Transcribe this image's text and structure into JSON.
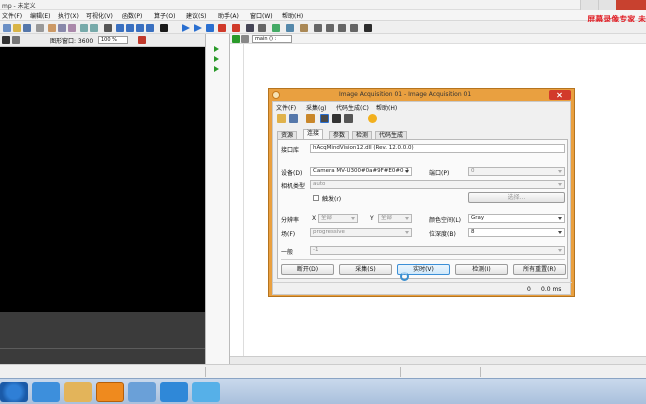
{
  "window": {
    "title": "mp - 未定义"
  },
  "menu": [
    "文件(F)",
    "编辑(E)",
    "执行(X)",
    "可视化(V)",
    "函数(P)",
    "算子(O)",
    "建议(S)",
    "助手(A)",
    "窗口(W)",
    "帮助(H)"
  ],
  "brand": "屏幕录像专家 未",
  "graphics_window": {
    "label": "图形窗口: 3600",
    "zoom": "100 %"
  },
  "editor": {
    "location": "main () :"
  },
  "dialog": {
    "title": "Image Acquisition 01 - Image Acquisition 01",
    "menu": [
      "文件(F)",
      "采集(g)",
      "代码生成(C)",
      "帮助(H)"
    ],
    "tabs": [
      "资源",
      "连接",
      "参数",
      "检测",
      "代码生成"
    ],
    "active_tab": 1,
    "fields": {
      "interface_label": "接口库",
      "interface_value": "hAcqMindVision12.dll (Rev. 12.0.0.0)",
      "device_label": "设备(D)",
      "device_value": "Camera MV-U300#0a#9F#E0#0 2",
      "port_label": "端口(P)",
      "port_value": "0",
      "camtype_label": "相机类型",
      "camtype_value": "auto",
      "trigger_label": "触发(r)",
      "select_button": "选择...",
      "res_label": "分辨率",
      "res_x_label": "X",
      "res_x_value": "全部",
      "res_y_label": "Y",
      "res_y_value": "全部",
      "colorspace_label": "颜色空间(L)",
      "colorspace_value": "Gray",
      "field_label": "场(F)",
      "field_value": "progressive",
      "bitdepth_label": "位深度(B)",
      "bitdepth_value": "8",
      "general_label": "一般",
      "general_value": "-1"
    },
    "buttons": [
      "断开(D)",
      "采集(S)",
      "实时(V)",
      "检测(I)",
      "所有重置(R)"
    ],
    "status": {
      "left": "0",
      "right": "0.0 ms"
    }
  }
}
